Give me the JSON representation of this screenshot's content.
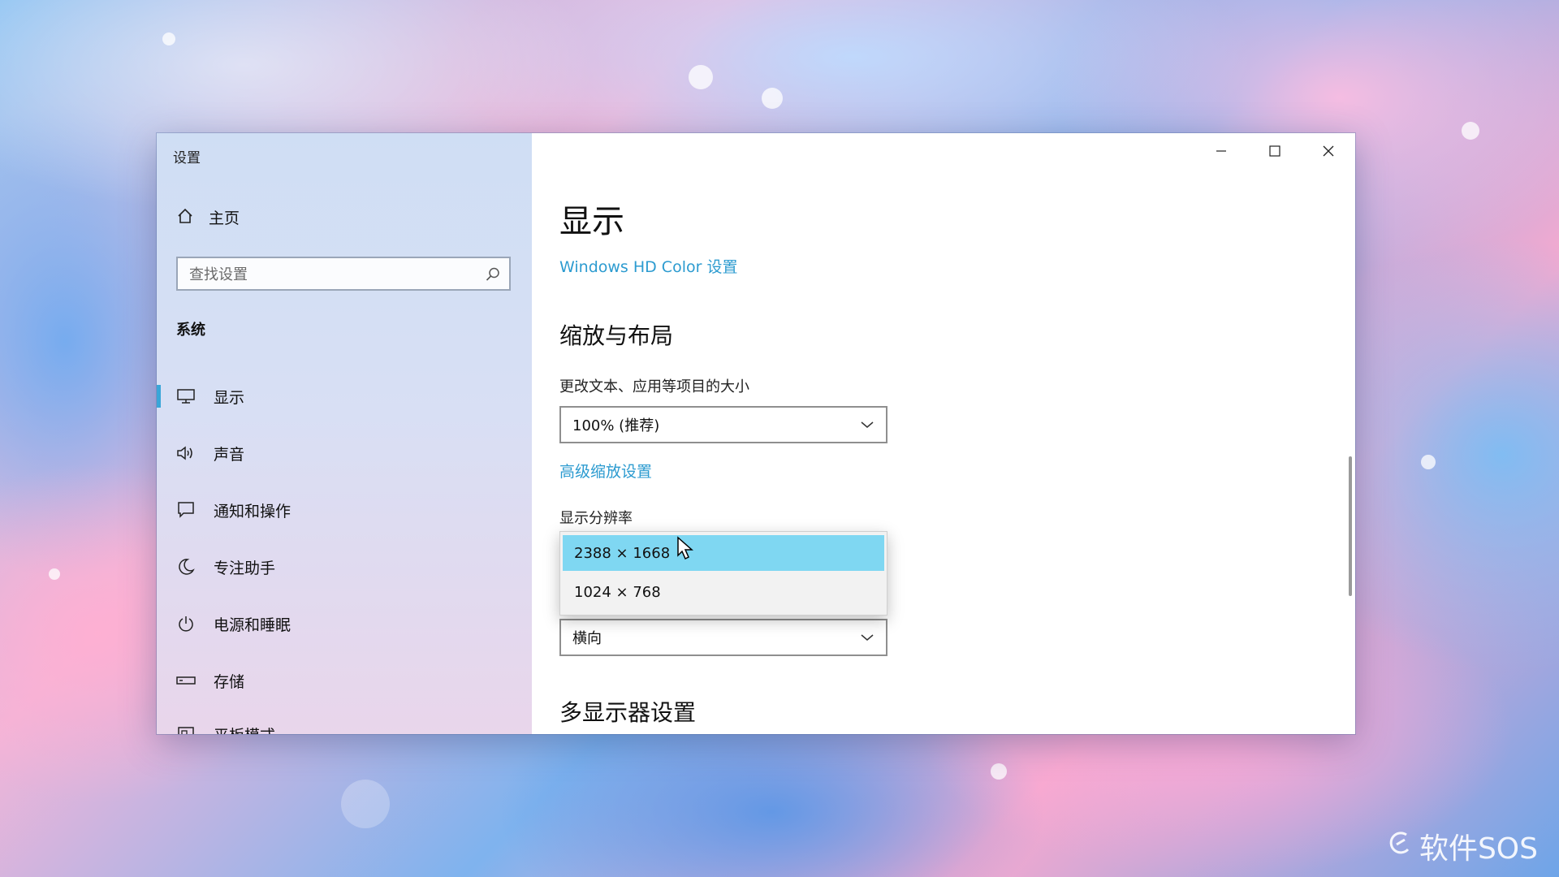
{
  "desktop": {
    "watermark": "软件SOS"
  },
  "window": {
    "title": "设置",
    "controls": {
      "minimize": "minimize-icon",
      "maximize": "maximize-icon",
      "close": "close-icon"
    }
  },
  "sidebar": {
    "home_label": "主页",
    "search_placeholder": "查找设置",
    "section_title": "系统",
    "items": [
      {
        "label": "显示",
        "icon": "monitor-icon",
        "active": true
      },
      {
        "label": "声音",
        "icon": "speaker-icon"
      },
      {
        "label": "通知和操作",
        "icon": "notification-icon"
      },
      {
        "label": "专注助手",
        "icon": "moon-icon"
      },
      {
        "label": "电源和睡眠",
        "icon": "power-icon"
      },
      {
        "label": "存储",
        "icon": "storage-icon"
      },
      {
        "label": "平板模式",
        "icon": "tablet-icon"
      }
    ]
  },
  "main": {
    "page_title": "显示",
    "hd_color_link": "Windows HD Color 设置",
    "scale_section": "缩放与布局",
    "scale_label": "更改文本、应用等项目的大小",
    "scale_value": "100% (推荐)",
    "advanced_scale_link": "高级缩放设置",
    "resolution_label": "显示分辨率",
    "resolution_options": [
      "2388 × 1668",
      "1024 × 768"
    ],
    "resolution_selected": "2388 × 1668",
    "orientation_value": "横向",
    "multi_display_section": "多显示器设置"
  },
  "colors": {
    "accent": "#2c9bd0",
    "selected_option": "#7fd7f2"
  }
}
